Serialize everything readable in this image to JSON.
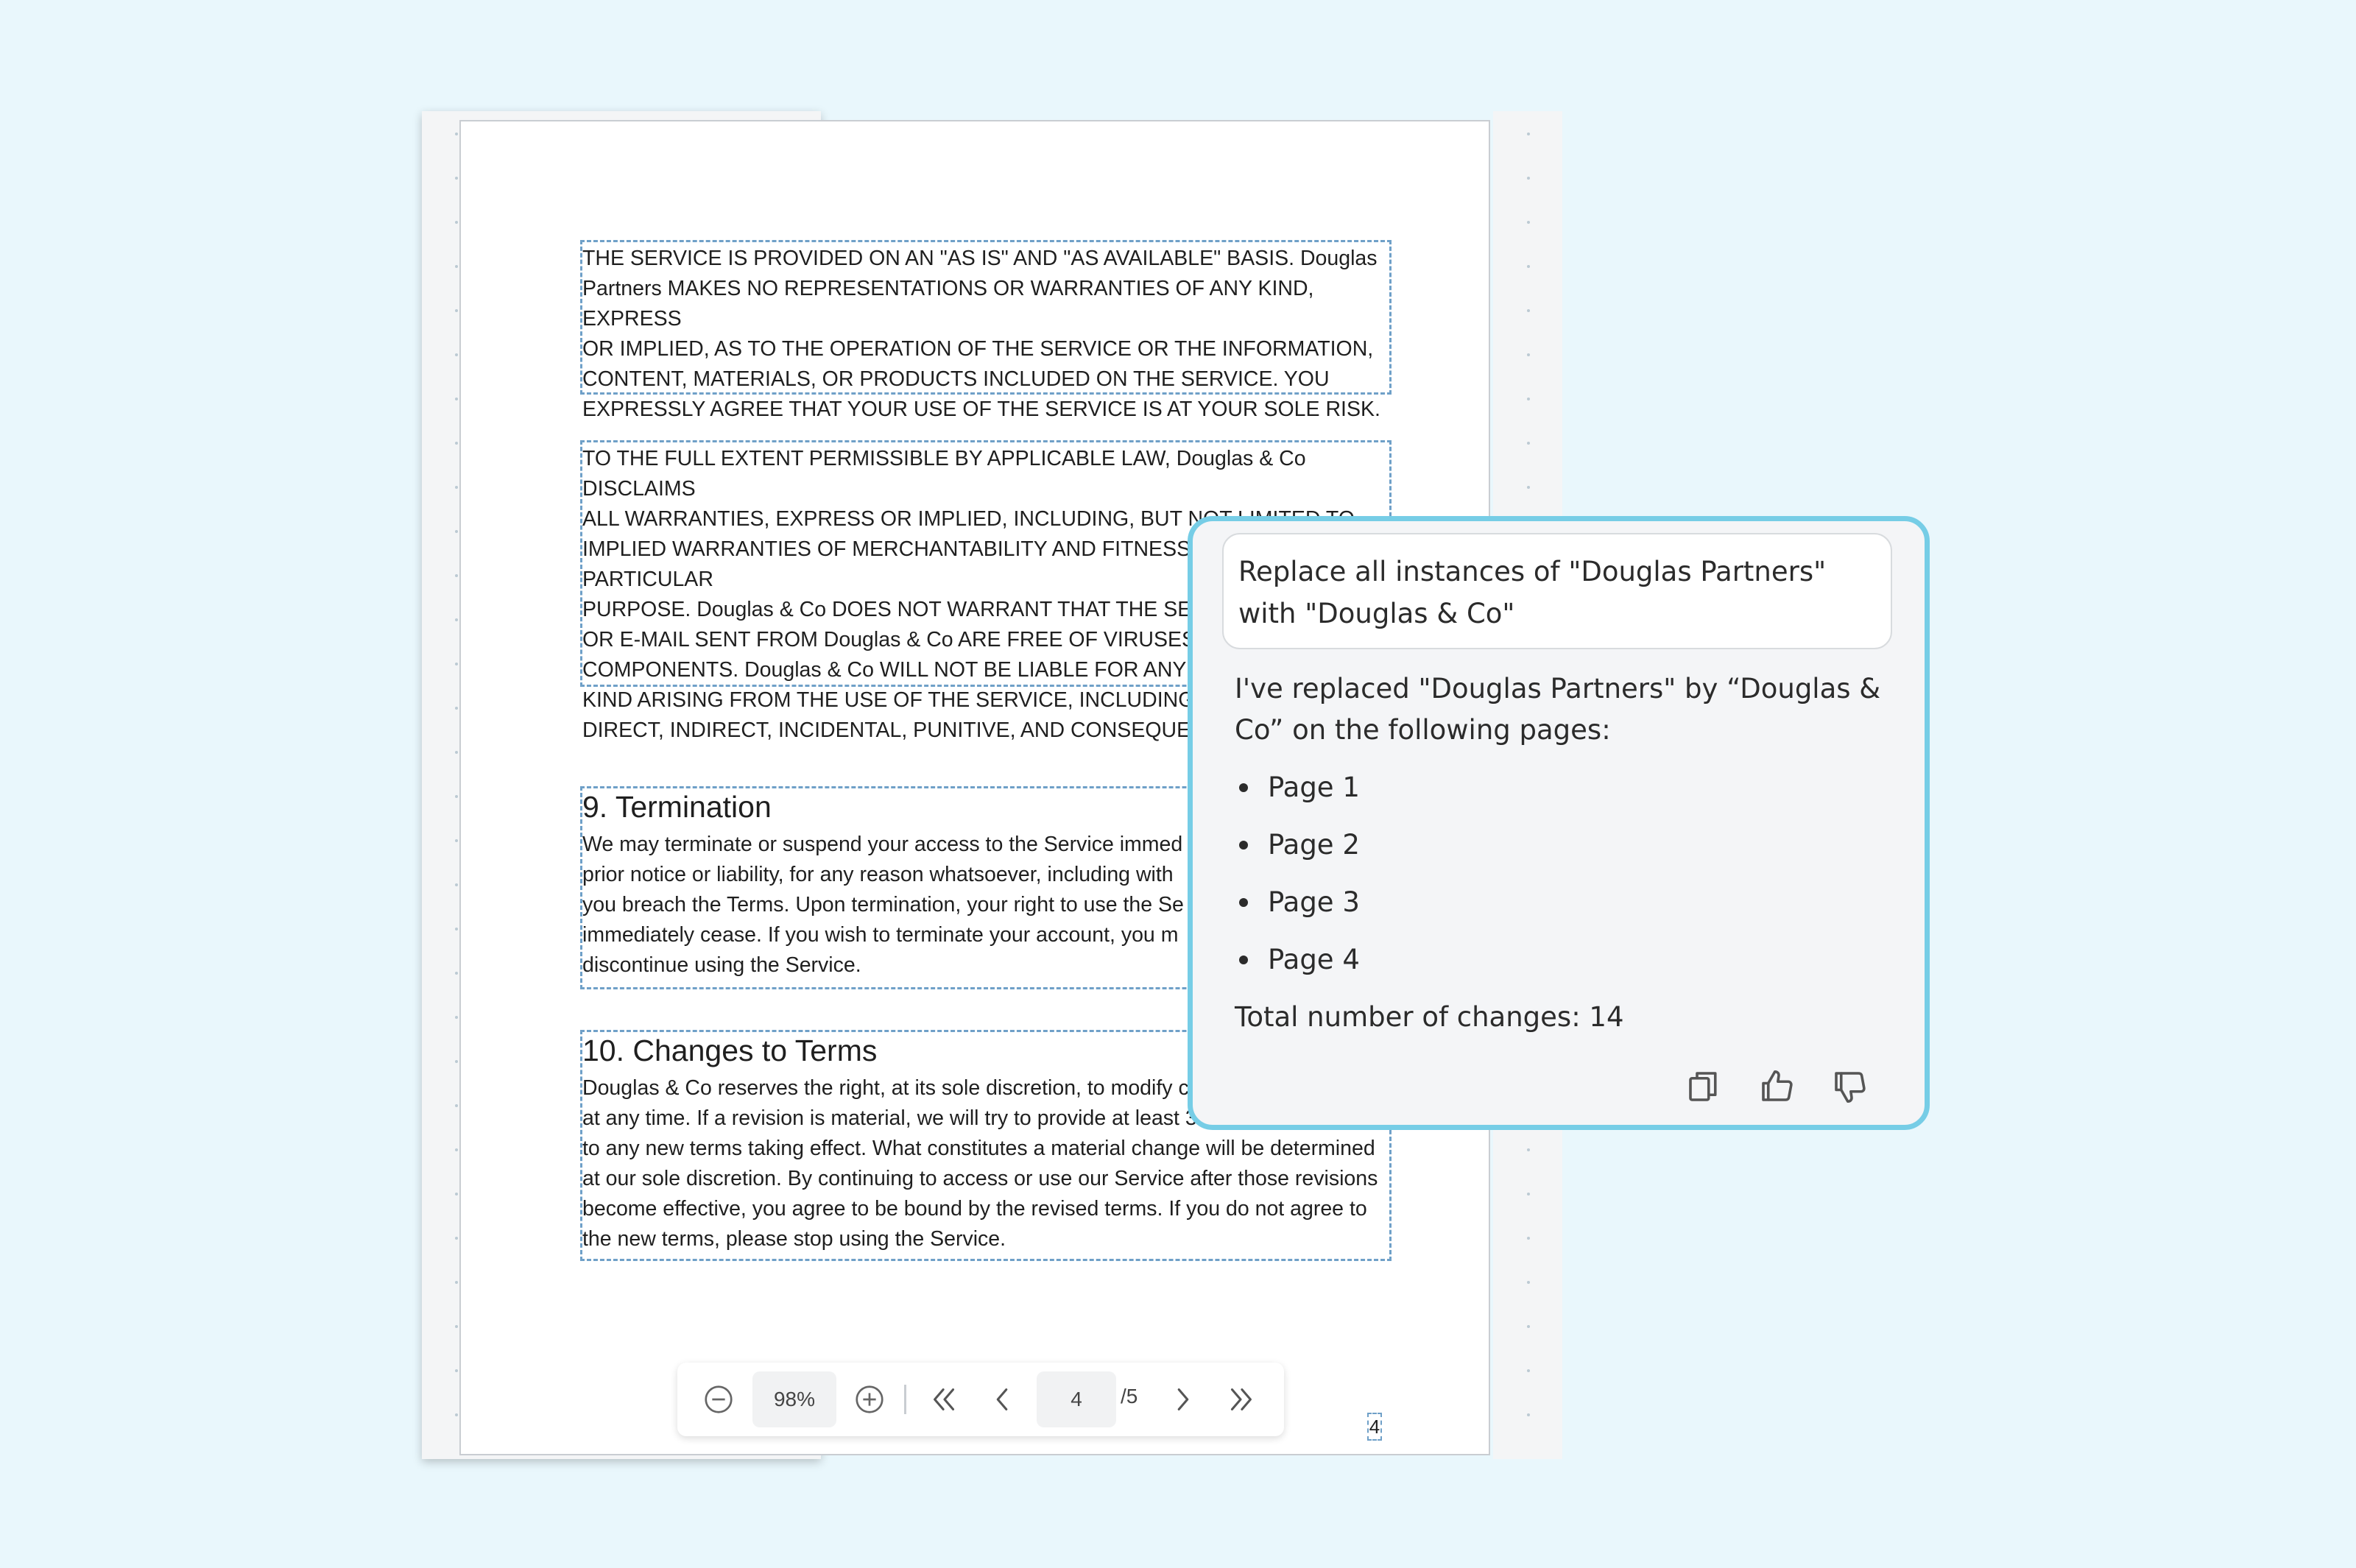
{
  "document": {
    "paragraph_1": "THE SERVICE IS PROVIDED ON AN \"AS IS\" AND \"AS AVAILABLE\" BASIS. Douglas\nPartners MAKES NO REPRESENTATIONS OR WARRANTIES OF ANY KIND, EXPRESS\nOR IMPLIED, AS TO THE OPERATION OF THE SERVICE OR THE INFORMATION,\nCONTENT, MATERIALS, OR PRODUCTS INCLUDED ON THE SERVICE. YOU\nEXPRESSLY AGREE THAT YOUR USE OF THE SERVICE IS AT YOUR SOLE RISK.",
    "paragraph_2": "TO THE FULL EXTENT PERMISSIBLE BY APPLICABLE LAW, Douglas & Co  DISCLAIMS\nALL WARRANTIES, EXPRESS OR IMPLIED, INCLUDING, BUT NOT LIMITED TO,\nIMPLIED WARRANTIES OF MERCHANTABILITY AND FITNESS FOR A PARTICULAR\nPURPOSE. Douglas & Co DOES NOT WARRANT THAT THE SERV\nOR E-MAIL SENT FROM Douglas & Co ARE FREE OF VIRUSES OR\nCOMPONENTS. Douglas & Co WILL NOT BE LIABLE FOR ANY DA\nKIND ARISING FROM THE USE OF THE SERVICE, INCLUDING, BU\nDIRECT, INDIRECT, INCIDENTAL, PUNITIVE, AND CONSEQUENT",
    "section_9_heading": "9. Termination",
    "section_9_body": "We may terminate or suspend your access to the Service immed\nprior notice or liability, for any reason whatsoever, including with\nyou breach the Terms. Upon termination, your right to use the Se\nimmediately cease. If you wish to terminate your account, you m\ndiscontinue using the Service.",
    "section_10_heading": "10. Changes to Terms",
    "section_10_body": "Douglas & Co reserves the right, at its sole discretion, to modify c\nat any time. If a revision is material, we will try to provide at least 30\nto any new terms taking effect. What constitutes a material change will be determined\nat our sole discretion. By continuing to access or use our Service after those revisions\nbecome effective, you agree to be bound by the revised terms. If you do not agree to\nthe new terms, please stop using the Service.",
    "page_number": "4"
  },
  "toolbar": {
    "zoom_out_icon": "minus-circle-icon",
    "zoom_level": "98%",
    "zoom_in_icon": "plus-circle-icon",
    "current_page": "4",
    "total_pages": "/5"
  },
  "chat": {
    "user_message": "Replace all instances of \"Douglas Partners\" with \"Douglas & Co\"",
    "reply_intro": "I've replaced \"Douglas Partners\" by “Douglas & Co” on the following pages:",
    "pages": [
      "Page 1",
      "Page 2",
      "Page 3",
      "Page 4"
    ],
    "total_changes": "Total number of changes: 14",
    "accent_color": "#76cde6"
  }
}
